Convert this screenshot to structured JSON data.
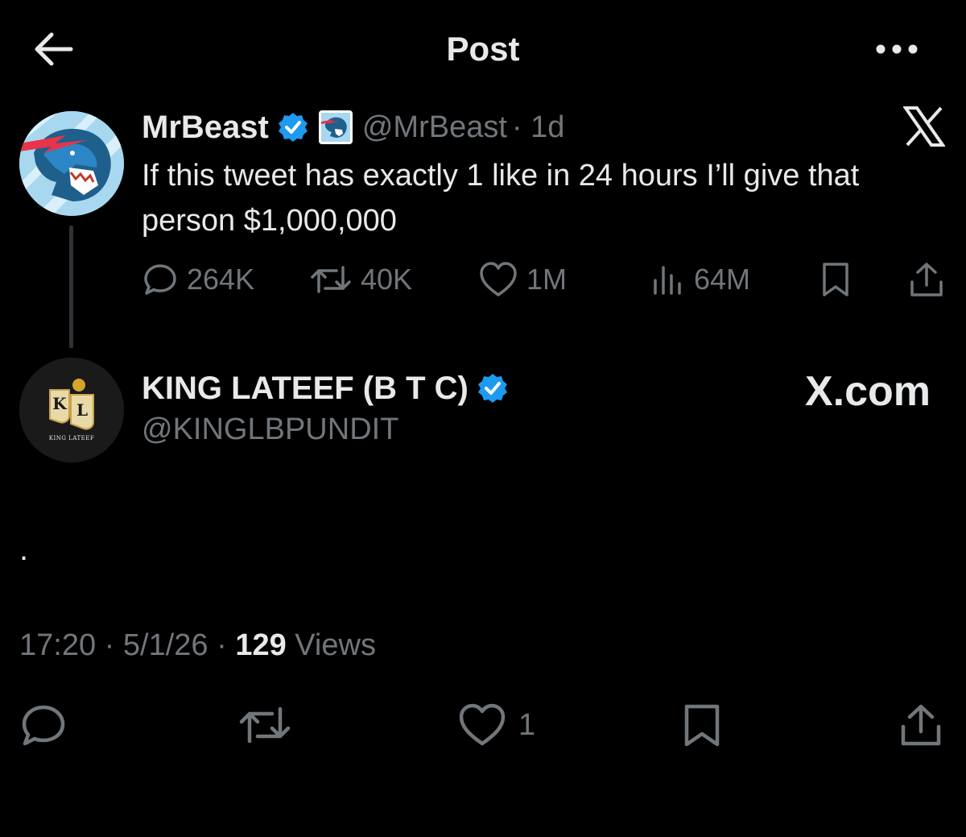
{
  "header": {
    "title": "Post"
  },
  "quoted": {
    "name": "MrBeast",
    "handle": "@MrBeast",
    "time": "· 1d",
    "text": "If this tweet has exactly 1 like in 24 hours I’ll give that person $1,000,000",
    "replies": "264K",
    "reposts": "40K",
    "likes": "1M",
    "views": "64M"
  },
  "reply": {
    "name": "KING LATEEF (B T C)",
    "handle": "@KINGLBPUNDIT",
    "badge_text": "X.com",
    "text": "."
  },
  "avatar2": {
    "monogram_k": "K",
    "monogram_l": "L",
    "caption": "KING LATEEF"
  },
  "meta": {
    "time": "17:20",
    "sep1": " · ",
    "date": "5/1/26",
    "sep2": " · ",
    "views": "129",
    "views_label": " Views"
  },
  "actions": {
    "likes": "1"
  },
  "colors": {
    "background": "#000000",
    "text": "#e7e9ea",
    "secondary": "#71767b",
    "verified": "#1d9bf0",
    "divider": "#2f3336"
  },
  "icons": {
    "back": "arrow-left-icon",
    "more": "more-dots-icon",
    "verified": "verified-badge-icon",
    "x": "x-logo-icon",
    "reply": "reply-icon",
    "repost": "repost-icon",
    "like": "heart-icon",
    "views": "views-bar-icon",
    "bookmark": "bookmark-icon",
    "share": "share-icon"
  }
}
